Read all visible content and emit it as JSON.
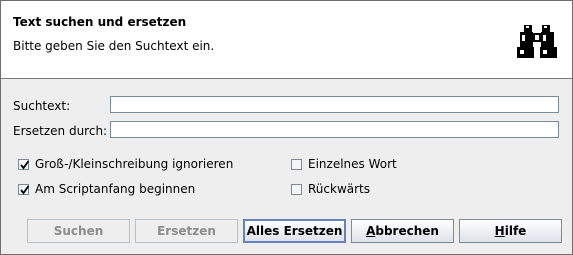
{
  "banner": {
    "title": "Text suchen und ersetzen",
    "subtitle": "Bitte geben Sie den Suchtext ein.",
    "icon": "binoculars-icon"
  },
  "fields": {
    "search_label": "Suchtext:",
    "search_value": "",
    "replace_label": "Ersetzen durch:",
    "replace_value": ""
  },
  "options": {
    "ignore_case": {
      "label": "Groß-/Kleinschreibung ignorieren",
      "checked": true
    },
    "from_start": {
      "label": "Am Scriptanfang beginnen",
      "checked": true
    },
    "whole_word": {
      "label": "Einzelnes Wort",
      "checked": false
    },
    "backwards": {
      "label": "Rückwärts",
      "checked": false
    }
  },
  "buttons": {
    "search": {
      "label": "Suchen",
      "enabled": false
    },
    "replace": {
      "label": "Ersetzen",
      "enabled": false
    },
    "replace_all": {
      "label": "Alles Ersetzen",
      "enabled": true
    },
    "cancel": {
      "label": "Abbrechen",
      "mnemonic": "A",
      "enabled": true
    },
    "help": {
      "label": "Hilfe",
      "mnemonic": "H",
      "enabled": true
    }
  },
  "colors": {
    "dialog_bg": "#eeeeee",
    "banner_bg": "#ffffff",
    "focus_border": "#6382bf",
    "disabled_text": "#8c8c8c"
  }
}
